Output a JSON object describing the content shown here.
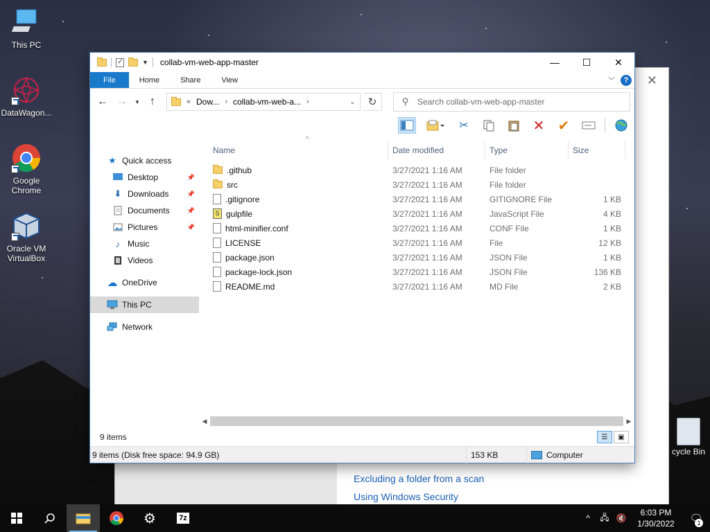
{
  "desktop": {
    "icons": [
      {
        "label": "This PC"
      },
      {
        "label": "DataWagon..."
      },
      {
        "label": "Google Chrome"
      },
      {
        "label": "Oracle VM VirtualBox"
      }
    ],
    "recycle_label": "cycle Bin"
  },
  "background_window": {
    "links": [
      "Excluding a folder from a scan",
      "Using Windows Security"
    ]
  },
  "explorer": {
    "title": "collab-vm-web-app-master",
    "ribbon_tabs": [
      "File",
      "Home",
      "Share",
      "View"
    ],
    "address": {
      "crumbs": [
        "Dow...",
        "collab-vm-web-a..."
      ],
      "prefix": "«"
    },
    "search_placeholder": "Search collab-vm-web-app-master",
    "nav": {
      "quick_access": "Quick access",
      "quick_items": [
        {
          "label": "Desktop",
          "pinned": true
        },
        {
          "label": "Downloads",
          "pinned": true
        },
        {
          "label": "Documents",
          "pinned": true
        },
        {
          "label": "Pictures",
          "pinned": true
        },
        {
          "label": "Music",
          "pinned": false
        },
        {
          "label": "Videos",
          "pinned": false
        }
      ],
      "onedrive": "OneDrive",
      "this_pc": "This PC",
      "network": "Network"
    },
    "columns": {
      "name": "Name",
      "date": "Date modified",
      "type": "Type",
      "size": "Size"
    },
    "files": [
      {
        "name": ".github",
        "date": "3/27/2021 1:16 AM",
        "type": "File folder",
        "size": "",
        "icon": "folder-icon"
      },
      {
        "name": "src",
        "date": "3/27/2021 1:16 AM",
        "type": "File folder",
        "size": "",
        "icon": "folder-icon"
      },
      {
        "name": ".gitignore",
        "date": "3/27/2021 1:16 AM",
        "type": "GITIGNORE File",
        "size": "1 KB",
        "icon": "file-icon"
      },
      {
        "name": "gulpfile",
        "date": "3/27/2021 1:16 AM",
        "type": "JavaScript File",
        "size": "4 KB",
        "icon": "javascript-file-icon"
      },
      {
        "name": "html-minifier.conf",
        "date": "3/27/2021 1:16 AM",
        "type": "CONF File",
        "size": "1 KB",
        "icon": "file-icon"
      },
      {
        "name": "LICENSE",
        "date": "3/27/2021 1:16 AM",
        "type": "File",
        "size": "12 KB",
        "icon": "file-icon"
      },
      {
        "name": "package.json",
        "date": "3/27/2021 1:16 AM",
        "type": "JSON File",
        "size": "1 KB",
        "icon": "file-icon"
      },
      {
        "name": "package-lock.json",
        "date": "3/27/2021 1:16 AM",
        "type": "JSON File",
        "size": "136 KB",
        "icon": "file-icon"
      },
      {
        "name": "README.md",
        "date": "3/27/2021 1:16 AM",
        "type": "MD File",
        "size": "2 KB",
        "icon": "file-icon"
      }
    ],
    "item_count": "9 items",
    "status": {
      "summary": "9 items (Disk free space: 94.9 GB)",
      "size": "153 KB",
      "location": "Computer"
    }
  },
  "taskbar": {
    "time": "6:03 PM",
    "date": "1/30/2022",
    "notification_count": "1"
  },
  "colors": {
    "accent": "#1979ca",
    "link": "#1a5fb4"
  }
}
